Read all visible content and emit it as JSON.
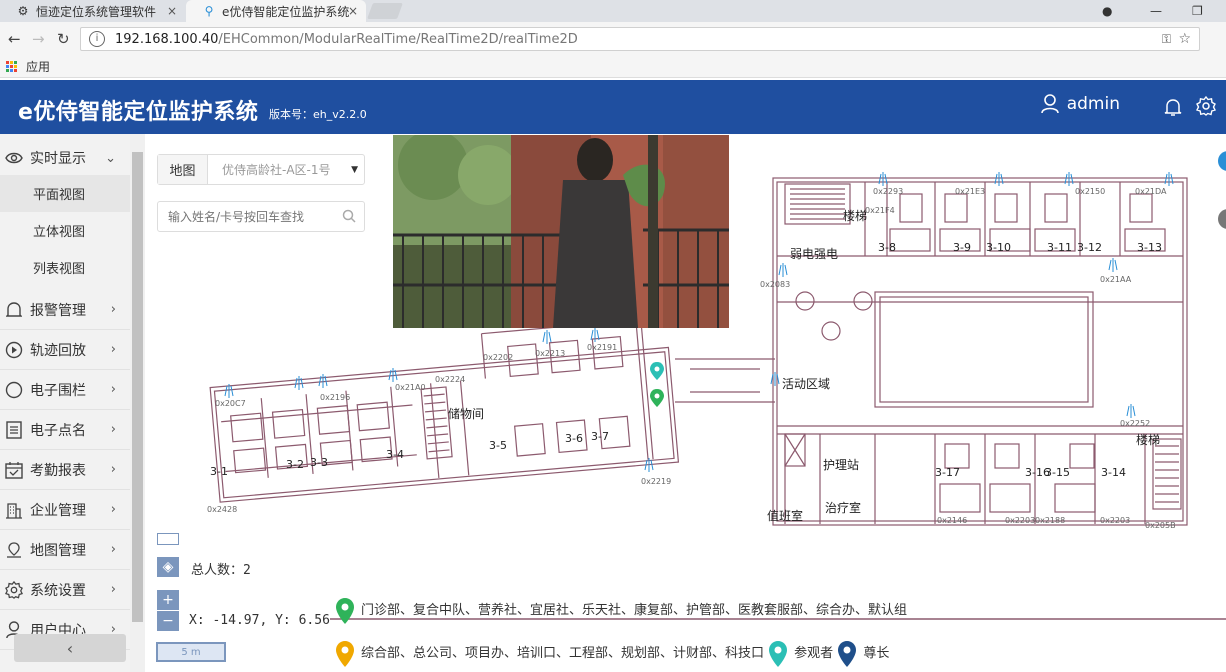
{
  "browser": {
    "tabs": [
      {
        "label": "恒迹定位系统管理软件",
        "close": "×"
      },
      {
        "label": "e优侍智能定位监护系统",
        "close": "×"
      }
    ],
    "url_host": "192.168.100.40",
    "url_path": "/EHCommon/ModularRealTime/RealTime2D/realTime2D",
    "bookmarks_label": "应用",
    "window_controls": [
      "—",
      "❐"
    ]
  },
  "header": {
    "title": "e优侍智能定位监护系统",
    "version": "版本号：eh_v2.2.0",
    "username": "admin"
  },
  "sidebar": {
    "items": [
      {
        "label": "实时显示",
        "icon": "eye-icon",
        "arrow": "⌄",
        "expanded": true
      },
      {
        "label": "报警管理",
        "icon": "alarm-icon",
        "arrow": "›"
      },
      {
        "label": "轨迹回放",
        "icon": "playback-icon",
        "arrow": "›"
      },
      {
        "label": "电子围栏",
        "icon": "circle-icon",
        "arrow": "›"
      },
      {
        "label": "电子点名",
        "icon": "list-icon",
        "arrow": "›"
      },
      {
        "label": "考勤报表",
        "icon": "calendar-icon",
        "arrow": "›"
      },
      {
        "label": "企业管理",
        "icon": "building-icon",
        "arrow": "›"
      },
      {
        "label": "地图管理",
        "icon": "map-pin-icon",
        "arrow": "›"
      },
      {
        "label": "系统设置",
        "icon": "gear-icon",
        "arrow": "›"
      },
      {
        "label": "用户中心",
        "icon": "user-icon",
        "arrow": "›"
      }
    ],
    "subitems": [
      {
        "label": "平面视图",
        "active": true
      },
      {
        "label": "立体视图",
        "active": false
      },
      {
        "label": "列表视图",
        "active": false
      }
    ],
    "collapse_label": "‹"
  },
  "map": {
    "map_label": "地图",
    "map_value": "优侍高龄社-A区-1号",
    "search_placeholder": "输入姓名/卡号按回车查找",
    "total_label": "总人数：",
    "total_value": "2",
    "coords_label": "X:",
    "x": "-14.97",
    "y_label": "Y:",
    "y": "6.56",
    "scale_label": "5 m",
    "zoom_in": "+",
    "zoom_out": "−",
    "room_labels": [
      "3-1",
      "3-2",
      "3-3",
      "3-4",
      "储物间",
      "3-5",
      "3-6",
      "3-7",
      "楼梯",
      "3-8",
      "3-9",
      "3-10",
      "3-11",
      "3-12",
      "3-13",
      "弱电强电",
      "活动区域",
      "护理站",
      "治疗室",
      "值班室",
      "3-17",
      "3-16",
      "3-15",
      "3-14",
      "楼梯"
    ],
    "anchor_ids": [
      "0x20C7",
      "0x2428",
      "0x2202",
      "0x2213",
      "0x2224",
      "0x2191",
      "0x2219",
      "0x2083",
      "0x21AA",
      "0x2146",
      "0x2203",
      "0x2188",
      "0x2252",
      "0x205B",
      "0x2203",
      "0x21F4",
      "0x21E3",
      "0x2150",
      "0x21DA",
      "0x2293",
      "0x2196",
      "0x21A0"
    ]
  },
  "legend": [
    {
      "color": "#2fb35a",
      "text": "门诊部、复合中队、营养社、宜居社、乐天社、康复部、护管部、医教套服部、综合办、默认组"
    },
    {
      "color": "#f0a800",
      "text": "综合部、总公司、项目办、培训口、工程部、规划部、计财部、科技口"
    },
    {
      "color": "#2bbfb5",
      "text": "参观者"
    },
    {
      "color": "#1f4f8a",
      "text": "尊长"
    }
  ],
  "colors": {
    "header_bg": "#1f4fa0",
    "wall": "#8c5a6e",
    "blue": "#2a8fd6"
  }
}
